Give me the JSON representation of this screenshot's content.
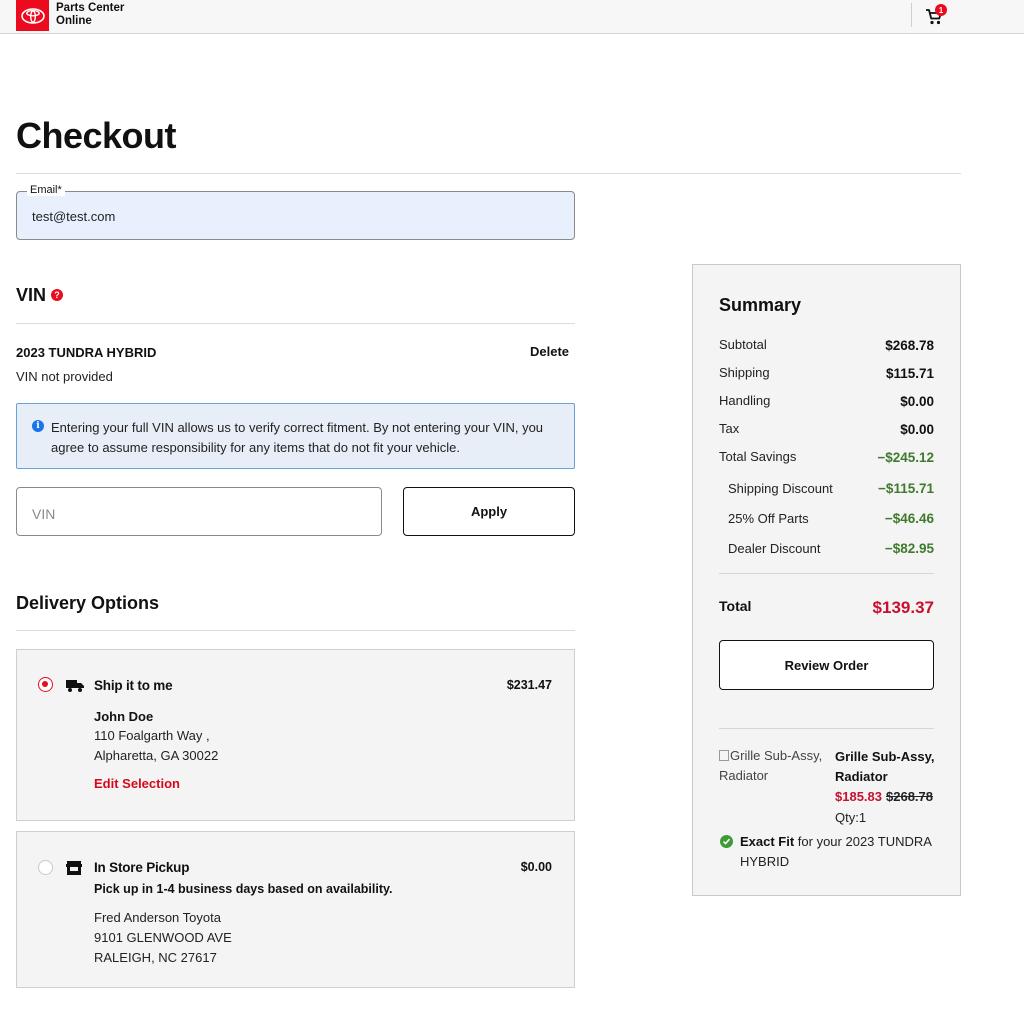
{
  "header": {
    "brand_line1": "Parts Center",
    "brand_line2": "Online",
    "cart_count": "1",
    "brand_color": "#eb0a1e"
  },
  "page": {
    "title": "Checkout"
  },
  "email": {
    "label": "Email*",
    "value": "test@test.com"
  },
  "vin_section": {
    "title": "VIN",
    "vehicle": "2023 TUNDRA HYBRID",
    "status": "VIN not provided",
    "delete_label": "Delete",
    "info_text": "Entering your full VIN allows us to verify correct fitment. By not entering your VIN, you agree to assume responsibility for any items that do not fit your vehicle.",
    "input_placeholder": "VIN",
    "apply_label": "Apply"
  },
  "delivery": {
    "title": "Delivery Options",
    "ship": {
      "title": "Ship it to me",
      "price": "$231.47",
      "selected": true,
      "name": "John Doe",
      "address1": "110 Foalgarth Way ,",
      "address2": "Alpharetta, GA 30022",
      "edit_label": "Edit Selection"
    },
    "pickup": {
      "title": "In Store Pickup",
      "price": "$0.00",
      "selected": false,
      "note": "Pick up in 1-4 business days based on availability.",
      "store": "Fred Anderson Toyota",
      "address1": "9101 GLENWOOD AVE",
      "address2": "RALEIGH, NC 27617"
    }
  },
  "summary": {
    "title": "Summary",
    "rows": [
      {
        "label": "Subtotal",
        "value": "$268.78"
      },
      {
        "label": "Shipping",
        "value": "$115.71"
      },
      {
        "label": "Handling",
        "value": "$0.00"
      },
      {
        "label": "Tax",
        "value": "$0.00"
      },
      {
        "label": "Total Savings",
        "value": "−$245.12"
      },
      {
        "label": "Shipping Discount",
        "value": "−$115.71"
      },
      {
        "label": "25% Off Parts",
        "value": "−$46.46"
      },
      {
        "label": "Dealer Discount",
        "value": "−$82.95"
      }
    ],
    "total_label": "Total",
    "total_value": "$139.37",
    "review_label": "Review Order",
    "item": {
      "image_alt": "Grille Sub-Assy, Radiator",
      "name": "Grille Sub-Assy, Radiator",
      "price": "$185.83",
      "original_price": "$268.78",
      "qty": "Qty:1",
      "fit_strong": "Exact Fit",
      "fit_rest": " for your 2023 TUNDRA HYBRID"
    }
  }
}
